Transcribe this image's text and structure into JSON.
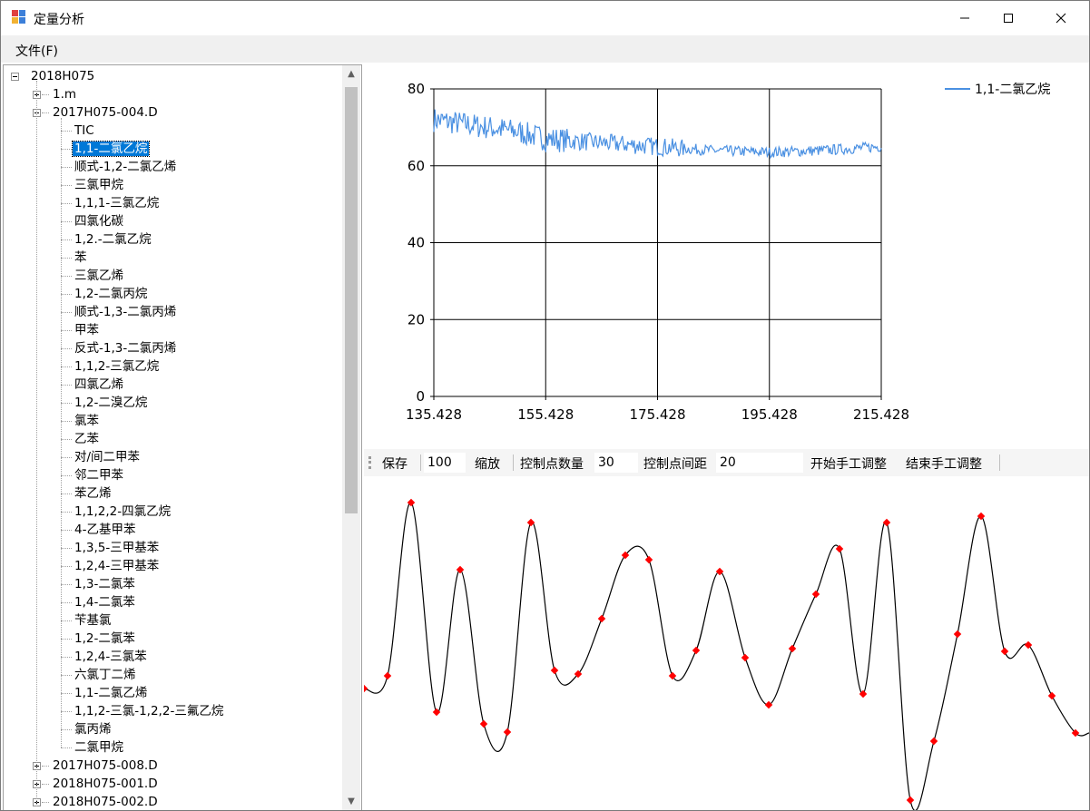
{
  "window": {
    "title": "定量分析"
  },
  "menu": {
    "file": "文件(F)"
  },
  "tree": {
    "root": "2018H075",
    "items": [
      {
        "label": "1.m",
        "level": 1,
        "expander": "plus"
      },
      {
        "label": "2017H075-004.D",
        "level": 1,
        "expander": "minus"
      },
      {
        "label": "TIC",
        "level": 2
      },
      {
        "label": "1,1-二氯乙烷",
        "level": 2,
        "selected": true
      },
      {
        "label": "顺式-1,2-二氯乙烯",
        "level": 2
      },
      {
        "label": "三氯甲烷",
        "level": 2
      },
      {
        "label": "1,1,1-三氯乙烷",
        "level": 2
      },
      {
        "label": "四氯化碳",
        "level": 2
      },
      {
        "label": "1,2.-二氯乙烷",
        "level": 2
      },
      {
        "label": "苯",
        "level": 2
      },
      {
        "label": "三氯乙烯",
        "level": 2
      },
      {
        "label": "1,2-二氯丙烷",
        "level": 2
      },
      {
        "label": "顺式-1,3-二氯丙烯",
        "level": 2
      },
      {
        "label": "甲苯",
        "level": 2
      },
      {
        "label": "反式-1,3-二氯丙烯",
        "level": 2
      },
      {
        "label": "1,1,2-三氯乙烷",
        "level": 2
      },
      {
        "label": "四氯乙烯",
        "level": 2
      },
      {
        "label": "1,2-二溴乙烷",
        "level": 2
      },
      {
        "label": "氯苯",
        "level": 2
      },
      {
        "label": "乙苯",
        "level": 2
      },
      {
        "label": "对/间二甲苯",
        "level": 2
      },
      {
        "label": "邻二甲苯",
        "level": 2
      },
      {
        "label": "苯乙烯",
        "level": 2
      },
      {
        "label": "1,1,2,2-四氯乙烷",
        "level": 2
      },
      {
        "label": "4-乙基甲苯",
        "level": 2
      },
      {
        "label": "1,3,5-三甲基苯",
        "level": 2
      },
      {
        "label": "1,2,4-三甲基苯",
        "level": 2
      },
      {
        "label": "1,3-二氯苯",
        "level": 2
      },
      {
        "label": "1,4-二氯苯",
        "level": 2
      },
      {
        "label": "苄基氯",
        "level": 2
      },
      {
        "label": "1,2-二氯苯",
        "level": 2
      },
      {
        "label": "1,2,4-三氯苯",
        "level": 2
      },
      {
        "label": "六氯丁二烯",
        "level": 2
      },
      {
        "label": "1,1-二氯乙烯",
        "level": 2
      },
      {
        "label": "1,1,2-三氯-1,2,2-三氟乙烷",
        "level": 2
      },
      {
        "label": "氯丙烯",
        "level": 2
      },
      {
        "label": "二氯甲烷",
        "level": 2
      },
      {
        "label": "2017H075-008.D",
        "level": 1,
        "expander": "plus"
      },
      {
        "label": "2018H075-001.D",
        "level": 1,
        "expander": "plus"
      },
      {
        "label": "2018H075-002.D",
        "level": 1,
        "expander": "plus"
      }
    ]
  },
  "toolbar": {
    "save": "保存",
    "zoom_value": "100",
    "zoom": "缩放",
    "ctrl_count_label": "控制点数量",
    "ctrl_count_value": "30",
    "ctrl_spacing_label": "控制点间距",
    "ctrl_spacing_value": "20",
    "start_manual": "开始手工调整",
    "end_manual": "结束手工调整"
  },
  "colors": {
    "series": "#4a90e2",
    "control_point": "#ff0000",
    "selection": "#0078d7"
  },
  "chart_data": {
    "type": "line",
    "series": [
      {
        "name": "1,1-二氯乙烷"
      }
    ],
    "xlim": [
      135.428,
      215.428
    ],
    "ylim": [
      0,
      80
    ],
    "x_ticks": [
      "135.428",
      "155.428",
      "175.428",
      "195.428",
      "215.428"
    ],
    "y_ticks": [
      "0",
      "20",
      "40",
      "60",
      "80"
    ],
    "grid": true,
    "legend": "top-right",
    "trend": {
      "x": [
        135.428,
        145,
        150,
        155.428,
        165,
        175.428,
        185,
        195.428,
        205,
        215.428
      ],
      "y": [
        72,
        70,
        69,
        67,
        66,
        65,
        64,
        63.5,
        64,
        65
      ]
    }
  }
}
